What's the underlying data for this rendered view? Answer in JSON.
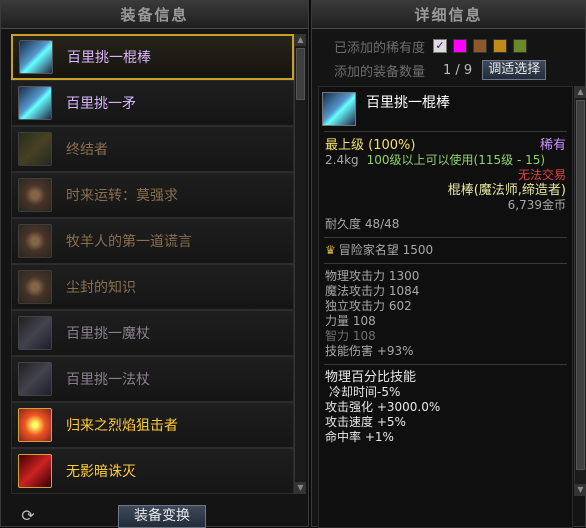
{
  "left_panel": {
    "title": "装备信息",
    "items": [
      {
        "name": "百里挑一棍棒",
        "color": "c-purple",
        "icon": "staff-icon",
        "icon_style": "icon-blue",
        "selected": true
      },
      {
        "name": "百里挑一矛",
        "color": "c-purple",
        "icon": "spear-icon",
        "icon_style": "icon-blue",
        "selected": false
      },
      {
        "name": "终结者",
        "color": "c-dim",
        "icon": "weapon-icon",
        "icon_style": "icon-green",
        "selected": false
      },
      {
        "name": "时来运转：莫强求",
        "color": "c-dim",
        "icon": "sun-icon",
        "icon_style": "icon-sun",
        "selected": false
      },
      {
        "name": "牧羊人的第一道谎言",
        "color": "c-dim",
        "icon": "orb-icon",
        "icon_style": "icon-sun",
        "selected": false
      },
      {
        "name": "尘封的知识",
        "color": "c-dim",
        "icon": "book-icon",
        "icon_style": "icon-sun",
        "selected": false
      },
      {
        "name": "百里挑一魔杖",
        "color": "c-dimgray",
        "icon": "wand-icon",
        "icon_style": "icon-gray",
        "selected": false
      },
      {
        "name": "百里挑一法杖",
        "color": "c-dimgray",
        "icon": "rod-icon",
        "icon_style": "icon-gray",
        "selected": false
      },
      {
        "name": "归来之烈焰狙击者",
        "color": "c-gold",
        "icon": "flame-icon",
        "icon_style": "icon-fire",
        "selected": false
      },
      {
        "name": "无影暗诛灭",
        "color": "c-gold",
        "icon": "blade-icon",
        "icon_style": "icon-red",
        "selected": false
      }
    ],
    "swap_button": "装备变换",
    "refresh_icon": "refresh-icon"
  },
  "right_panel": {
    "title": "详细信息",
    "rarity_label": "已添加的稀有度",
    "rarity_swatches": [
      "#ff00ff",
      "#8a5a2a",
      "#c08a18",
      "#6a8a2a"
    ],
    "count_label": "添加的装备数量",
    "count_value": "1 / 9",
    "adjust_button": "调适选择",
    "tooltip": {
      "name": "百里挑一棍棒",
      "grade": "最上级 (100%)",
      "rarity": "稀有",
      "weight": "2.4kg",
      "level_req": "100级以上可以使用(115级 - 15)",
      "trade": "无法交易",
      "type": "棍棒(魔法师,缔造者)",
      "price": "6,739金币",
      "durability": "耐久度 48/48",
      "fame": "冒险家名望 1500",
      "stats": [
        {
          "text": "物理攻击力 1300",
          "color": "c-gray"
        },
        {
          "text": "魔法攻击力 1084",
          "color": "c-gray"
        },
        {
          "text": "独立攻击力 602",
          "color": "c-gray"
        },
        {
          "text": "力量 108",
          "color": "c-gray"
        },
        {
          "text": "智力 108",
          "color": "c-darkgray"
        },
        {
          "text": "技能伤害 +93%",
          "color": "c-gray"
        }
      ],
      "skill_title": "物理百分比技能",
      "skill_lines": [
        {
          "text": "冷却时间-5%"
        },
        {
          "text": "攻击强化 +3000.0%"
        },
        {
          "text": "攻击速度 +5%"
        },
        {
          "text": "命中率 +1%"
        }
      ]
    }
  }
}
